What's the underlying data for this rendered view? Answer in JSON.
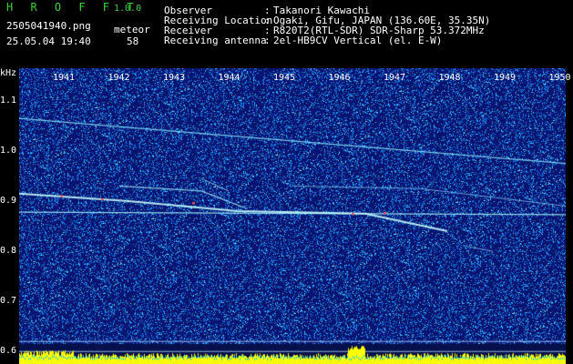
{
  "app": {
    "name": "H R O F F T",
    "version": "1.0.0",
    "filename": "2505041940.png",
    "datetime": "25.05.04 19:40",
    "meteor_label": "meteor",
    "meteor_count": "58"
  },
  "info": [
    {
      "label": "Observer",
      "value": "Takanori Kawachi"
    },
    {
      "label": "Receiving Location",
      "value": "Ogaki, Gifu, JAPAN (136.60E, 35.35N)"
    },
    {
      "label": "Receiver",
      "value": "R820T2(RTL-SDR) SDR-Sharp 53.372MHz"
    },
    {
      "label": "Receiving antenna",
      "value": "2el-HB9CV Vertical (el. E-W)"
    }
  ],
  "chart_data": {
    "type": "heatmap",
    "x_ticks": [
      "1941",
      "1942",
      "1943",
      "1944",
      "1945",
      "1946",
      "1947",
      "1948",
      "1949",
      "1950"
    ],
    "y_unit": "kHz",
    "y_ticks": [
      "1.1",
      "1.0",
      "0.9",
      "0.8",
      "0.7",
      "0.6"
    ],
    "ylim": [
      0.575,
      1.165
    ],
    "colors": {
      "noise_bg": "#0b1a6e",
      "trace": "#8fe8ff",
      "hot": "#ff4040",
      "level": "#ffff00",
      "level_base": "#00bfff"
    }
  }
}
